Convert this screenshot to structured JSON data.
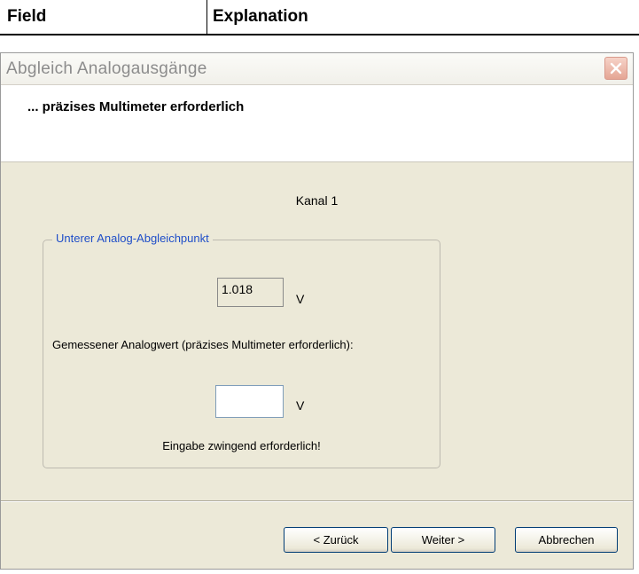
{
  "doc_table": {
    "col1": "Field",
    "col2": "Explanation"
  },
  "dialog": {
    "title": "Abgleich Analogausgänge",
    "header": "... präzises Multimeter erforderlich",
    "channel": "Kanal 1",
    "group": {
      "legend": "Unterer Analog-Abgleichpunkt",
      "value": "1.018",
      "unit": "V",
      "measure_label": "Gemessener Analogwert (präzises Multimeter erforderlich):",
      "input_value": "",
      "input_unit": "V",
      "hint": "Eingabe zwingend erforderlich!"
    },
    "buttons": {
      "back": "< Zurück",
      "next": "Weiter >",
      "cancel": "Abbrechen"
    }
  },
  "icons": {
    "close": "close-icon"
  }
}
